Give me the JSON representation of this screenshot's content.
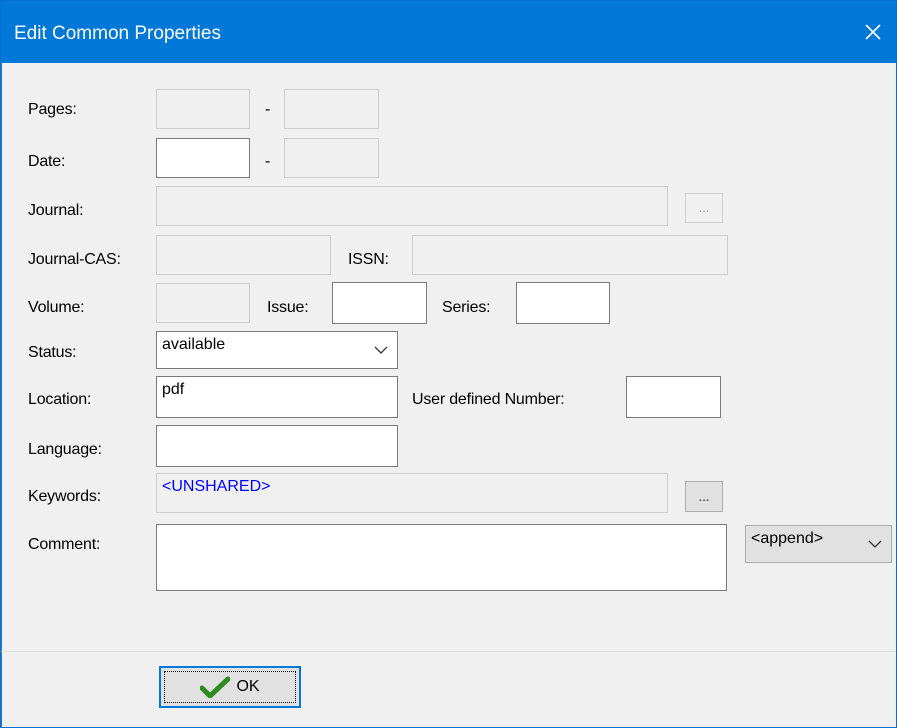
{
  "window": {
    "title": "Edit Common Properties"
  },
  "fields": {
    "pages_label": "Pages:",
    "pages_sep": "-",
    "date_label": "Date:",
    "date_sep": "-",
    "journal_label": "Journal:",
    "journal_btn": "...",
    "journal_cas_label": "Journal-CAS:",
    "issn_label": "ISSN:",
    "volume_label": "Volume:",
    "issue_label": "Issue:",
    "series_label": "Series:",
    "status_label": "Status:",
    "status_value": "available",
    "location_label": "Location:",
    "location_value": "pdf",
    "user_number_label": "User defined Number:",
    "language_label": "Language:",
    "keywords_label": "Keywords:",
    "keywords_value": "<UNSHARED>",
    "keywords_btn": "...",
    "comment_label": "Comment:",
    "comment_mode": "<append>"
  },
  "footer": {
    "ok_label": "OK"
  },
  "colors": {
    "titlebar": "#0078d7",
    "unshared_text": "#0000ff",
    "ok_check": "#2e8b1f"
  },
  "icons": {
    "close": "close-icon",
    "dropdown": "chevron-down-icon",
    "ok": "checkmark-icon"
  }
}
